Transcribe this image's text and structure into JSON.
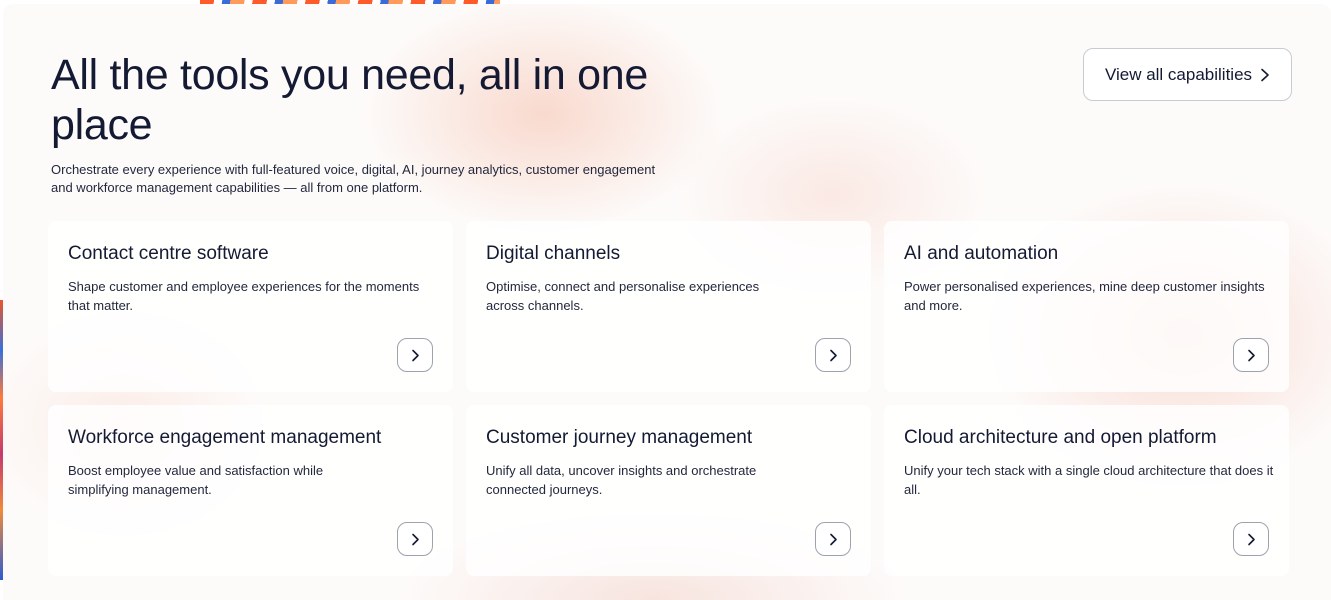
{
  "section": {
    "title": "All the tools you need, all in one place",
    "description": "Orchestrate every experience with full-featured voice, digital, AI, journey analytics, customer engagement and workforce management capabilities — all from one platform.",
    "view_all_label": "View all capabilities"
  },
  "cards": [
    {
      "title": "Contact centre software",
      "description": "Shape customer and employee experiences for the moments that matter."
    },
    {
      "title": "Digital channels",
      "description": "Optimise, connect and personalise experiences across channels."
    },
    {
      "title": "AI and automation",
      "description": "Power personalised experiences, mine deep customer insights and more."
    },
    {
      "title": "Workforce engagement management",
      "description": "Boost employee value and satisfaction while simplifying management."
    },
    {
      "title": "Customer journey management",
      "description": "Unify all data, uncover insights and orchestrate connected journeys."
    },
    {
      "title": "Cloud architecture and open platform",
      "description": "Unify your tech stack with a single cloud architecture that does it all."
    }
  ],
  "icons": {
    "arrow": "chevron-right-icon"
  },
  "colors": {
    "text": "#141a33",
    "border": "#c9cbd3",
    "accent_glow": "#f5beaa"
  }
}
